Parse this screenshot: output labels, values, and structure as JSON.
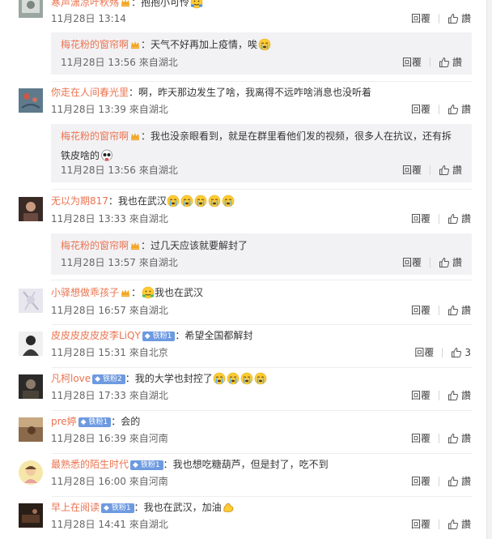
{
  "ui": {
    "reply_label": "回覆",
    "like_label": "讚",
    "from_prefix": "來自"
  },
  "comments": [
    {
      "user": "寒声潇凉叶秋殇",
      "text": "抱抱小可怜",
      "time": "11月28日 13:14",
      "location": "",
      "likes": "",
      "reply": {
        "user": "梅花粉的窗帘啊",
        "text": "天气不好再加上疫情，唉",
        "time": "11月28日 13:56",
        "location": "湖北",
        "likes": ""
      }
    },
    {
      "user": "你走在人间春光里",
      "text": "啊，昨天那边发生了啥，我离得不远咋啥消息也没听着",
      "time": "11月28日 13:39",
      "location": "湖北",
      "likes": "",
      "reply": {
        "user": "梅花粉的窗帘啊",
        "text_line1": "我也没亲眼看到，就是在群里看他们发的视频，很多人在抗议，还有拆",
        "text_line2": "铁皮啥的",
        "time": "11月28日 13:56",
        "location": "湖北",
        "likes": ""
      }
    },
    {
      "user": "无以为期817",
      "text": "我也在武汉",
      "time": "11月28日 13:33",
      "location": "湖北",
      "likes": "",
      "reply": {
        "user": "梅花粉的窗帘啊",
        "text": "过几天应该就要解封了",
        "time": "11月28日 13:57",
        "location": "湖北",
        "likes": ""
      }
    },
    {
      "user": "小驿想做乖孩子",
      "text": "我也在武汉",
      "time": "11月28日 16:57",
      "location": "湖北",
      "likes": ""
    },
    {
      "user": "皮皮皮皮皮皮李LiQY",
      "badge": "铁粉1",
      "text": "希望全国都解封",
      "time": "11月28日 15:31",
      "location": "北京",
      "likes": "3"
    },
    {
      "user": "凡柯love",
      "badge": "铁粉2",
      "text": "我的大学也封控了",
      "time": "11月28日 17:33",
      "location": "湖北",
      "likes": ""
    },
    {
      "user": "pre婷",
      "badge": "铁粉1",
      "text": "会的",
      "time": "11月28日 16:39",
      "location": "河南",
      "likes": ""
    },
    {
      "user": "最熟悉的陌生时代",
      "badge": "铁粉1",
      "text": "我也想吃糖葫芦，但是封了，吃不到",
      "time": "11月28日 16:00",
      "location": "河南",
      "likes": ""
    },
    {
      "user": "早上在阅读",
      "badge": "铁粉1",
      "text": "我也在武汉，加油",
      "time": "11月28日 14:41",
      "location": "湖北",
      "likes": ""
    }
  ],
  "colors": {
    "username": "#eb7350",
    "reply_bg": "#f2f2f5",
    "fan_badge": "#6d9ae0"
  },
  "icons": [
    "vip-crown-icon",
    "thumb-up-icon",
    "crying-emoji-icon",
    "hug-emoji-icon",
    "skull-emoji-icon",
    "strong-arm-emoji-icon"
  ]
}
